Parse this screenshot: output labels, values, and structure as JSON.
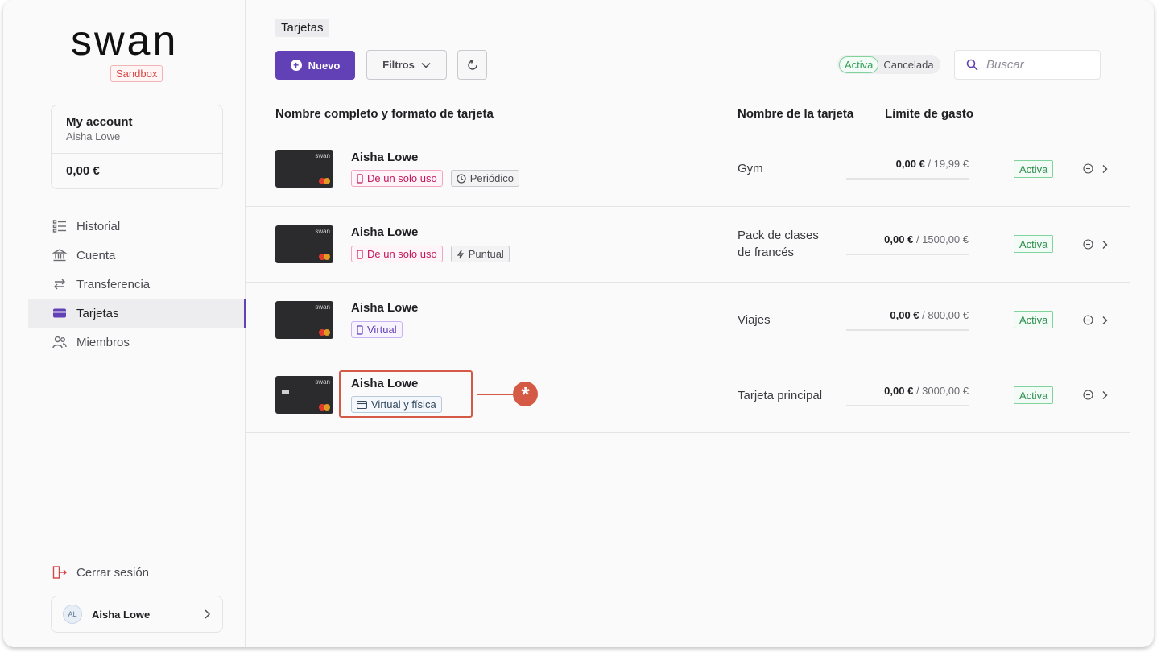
{
  "app": {
    "logo_text": "swan",
    "environment": "Sandbox"
  },
  "account": {
    "title": "My account",
    "owner": "Aisha Lowe",
    "balance": "0,00 €"
  },
  "nav": [
    {
      "label": "Historial",
      "icon": "list-icon"
    },
    {
      "label": "Cuenta",
      "icon": "bank-icon"
    },
    {
      "label": "Transferencia",
      "icon": "transfer-icon"
    },
    {
      "label": "Tarjetas",
      "icon": "card-icon",
      "active": true
    },
    {
      "label": "Miembros",
      "icon": "members-icon"
    }
  ],
  "logout_label": "Cerrar sesión",
  "user": {
    "initials": "AL",
    "name": "Aisha Lowe"
  },
  "page": {
    "title": "Tarjetas"
  },
  "toolbar": {
    "new_label": "Nuevo",
    "filters_label": "Filtros",
    "status_on": "Activa",
    "status_off": "Cancelada",
    "search_placeholder": "Buscar"
  },
  "columns": {
    "name_format": "Nombre completo y formato de tarjeta",
    "card_name": "Nombre de la tarjeta",
    "spend_limit": "Límite de gasto"
  },
  "card_brand": "swan",
  "rows": [
    {
      "holder": "Aisha Lowe",
      "tags": [
        {
          "label": "De un solo uso",
          "style": "pink",
          "icon": "phone-icon"
        },
        {
          "label": "Periódico",
          "style": "gray",
          "icon": "clock-icon"
        }
      ],
      "card_name": "Gym",
      "spent": "0,00 €",
      "limit": " / 19,99 €",
      "status": "Activa"
    },
    {
      "holder": "Aisha Lowe",
      "tags": [
        {
          "label": "De un solo uso",
          "style": "pink",
          "icon": "phone-icon"
        },
        {
          "label": "Puntual",
          "style": "gray",
          "icon": "bolt-icon"
        }
      ],
      "card_name_line1": "Pack de clases",
      "card_name_line2": "de francés",
      "spent": "0,00 €",
      "limit": " / 1500,00 €",
      "status": "Activa"
    },
    {
      "holder": "Aisha Lowe",
      "tags": [
        {
          "label": "Virtual",
          "style": "purple",
          "icon": "phone-icon"
        }
      ],
      "card_name": "Viajes",
      "spent": "0,00 €",
      "limit": " / 800,00 €",
      "status": "Activa"
    },
    {
      "holder": "Aisha Lowe",
      "tags": [
        {
          "label": "Virtual y física",
          "style": "blue",
          "icon": "card-icon"
        }
      ],
      "card_name": "Tarjeta principal",
      "spent": "0,00 €",
      "limit": " / 3000,00 €",
      "status": "Activa"
    }
  ],
  "callout": {
    "marker": "*",
    "color": "#d45a46"
  },
  "colors": {
    "accent": "#6240b5",
    "active_green": "#35a15a",
    "danger": "#d64545"
  }
}
